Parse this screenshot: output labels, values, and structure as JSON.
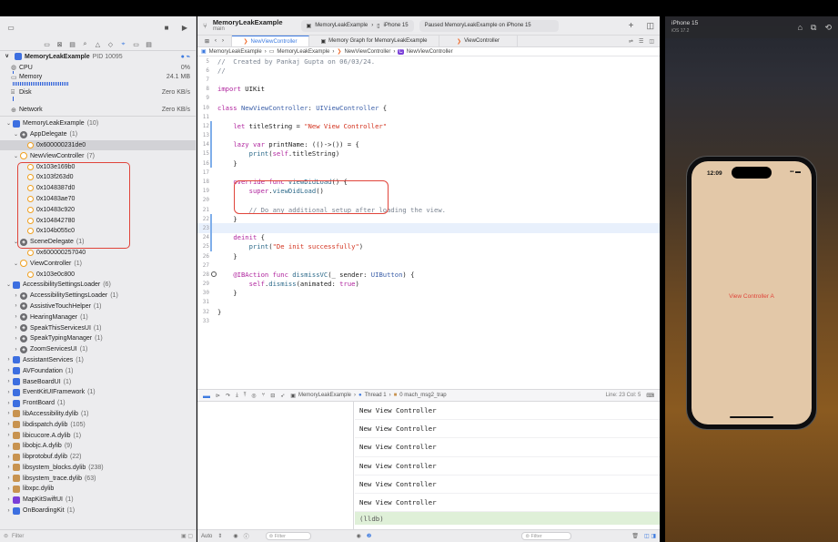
{
  "navigator": {
    "process": {
      "name": "MemoryLeakExample",
      "pid": "PID 10095"
    },
    "gauges": [
      {
        "label": "CPU",
        "value": "0%"
      },
      {
        "label": "Memory",
        "value": "24.1 MB"
      },
      {
        "label": "Disk",
        "value": "Zero KB/s"
      },
      {
        "label": "Network",
        "value": "Zero KB/s"
      }
    ],
    "tree": [
      {
        "indent": 0,
        "chev": "v",
        "icon": "blue",
        "label": "MemoryLeakExample",
        "count": "(10)"
      },
      {
        "indent": 1,
        "chev": "v",
        "icon": "gray",
        "label": "AppDelegate",
        "count": "(1)"
      },
      {
        "indent": 2,
        "chev": "",
        "icon": "obj",
        "label": "0x600000231de0",
        "count": "",
        "selected": true
      },
      {
        "indent": 1,
        "chev": "v",
        "icon": "orange",
        "label": "NewViewController",
        "count": "(7)"
      },
      {
        "indent": 2,
        "chev": "",
        "icon": "obj",
        "label": "0x103e169b0",
        "count": ""
      },
      {
        "indent": 2,
        "chev": "",
        "icon": "obj",
        "label": "0x103f263d0",
        "count": ""
      },
      {
        "indent": 2,
        "chev": "",
        "icon": "obj",
        "label": "0x1048387d0",
        "count": ""
      },
      {
        "indent": 2,
        "chev": "",
        "icon": "obj",
        "label": "0x10483ae70",
        "count": ""
      },
      {
        "indent": 2,
        "chev": "",
        "icon": "obj",
        "label": "0x10483c920",
        "count": ""
      },
      {
        "indent": 2,
        "chev": "",
        "icon": "obj",
        "label": "0x104842780",
        "count": ""
      },
      {
        "indent": 2,
        "chev": "",
        "icon": "obj",
        "label": "0x104b055c0",
        "count": ""
      },
      {
        "indent": 1,
        "chev": "v",
        "icon": "gray",
        "label": "SceneDelegate",
        "count": "(1)"
      },
      {
        "indent": 2,
        "chev": "",
        "icon": "obj",
        "label": "0x600000257040",
        "count": ""
      },
      {
        "indent": 1,
        "chev": "v",
        "icon": "orange",
        "label": "ViewController",
        "count": "(1)"
      },
      {
        "indent": 2,
        "chev": "",
        "icon": "obj",
        "label": "0x103e0c800",
        "count": ""
      },
      {
        "indent": 0,
        "chev": "v",
        "icon": "blue",
        "label": "AccessibilitySettingsLoader",
        "count": "(6)"
      },
      {
        "indent": 1,
        "chev": ">",
        "icon": "gray",
        "label": "AccessibilitySettingsLoader",
        "count": "(1)"
      },
      {
        "indent": 1,
        "chev": ">",
        "icon": "gray",
        "label": "AssistiveTouchHelper",
        "count": "(1)"
      },
      {
        "indent": 1,
        "chev": ">",
        "icon": "gray",
        "label": "HearingManager",
        "count": "(1)"
      },
      {
        "indent": 1,
        "chev": ">",
        "icon": "gray",
        "label": "SpeakThisServicesUI",
        "count": "(1)"
      },
      {
        "indent": 1,
        "chev": ">",
        "icon": "gray",
        "label": "SpeakTypingManager",
        "count": "(1)"
      },
      {
        "indent": 1,
        "chev": ">",
        "icon": "gray",
        "label": "ZoomServicesUI",
        "count": "(1)"
      },
      {
        "indent": 0,
        "chev": ">",
        "icon": "blue",
        "label": "AssistantServices",
        "count": "(1)"
      },
      {
        "indent": 0,
        "chev": ">",
        "icon": "blue",
        "label": "AVFoundation",
        "count": "(1)"
      },
      {
        "indent": 0,
        "chev": ">",
        "icon": "blue",
        "label": "BaseBoardUI",
        "count": "(1)"
      },
      {
        "indent": 0,
        "chev": ">",
        "icon": "blue",
        "label": "EventKitUIFramework",
        "count": "(1)"
      },
      {
        "indent": 0,
        "chev": ">",
        "icon": "blue",
        "label": "FrontBoard",
        "count": "(1)"
      },
      {
        "indent": 0,
        "chev": ">",
        "icon": "lib",
        "label": "libAccessibility.dylib",
        "count": "(1)"
      },
      {
        "indent": 0,
        "chev": ">",
        "icon": "lib",
        "label": "libdispatch.dylib",
        "count": "(105)"
      },
      {
        "indent": 0,
        "chev": ">",
        "icon": "lib",
        "label": "libicucore.A.dylib",
        "count": "(1)"
      },
      {
        "indent": 0,
        "chev": ">",
        "icon": "lib",
        "label": "libobjc.A.dylib",
        "count": "(9)"
      },
      {
        "indent": 0,
        "chev": ">",
        "icon": "lib",
        "label": "libprotobuf.dylib",
        "count": "(22)"
      },
      {
        "indent": 0,
        "chev": ">",
        "icon": "lib",
        "label": "libsystem_blocks.dylib",
        "count": "(238)"
      },
      {
        "indent": 0,
        "chev": ">",
        "icon": "lib",
        "label": "libsystem_trace.dylib",
        "count": "(63)"
      },
      {
        "indent": 0,
        "chev": ">",
        "icon": "lib",
        "label": "libxpc.dylib",
        "count": ""
      },
      {
        "indent": 0,
        "chev": ">",
        "icon": "swift",
        "label": "MapKitSwiftUI",
        "count": "(1)"
      },
      {
        "indent": 0,
        "chev": ">",
        "icon": "blue",
        "label": "OnBoardingKit",
        "count": "(1)"
      }
    ],
    "filter_placeholder": "Filter"
  },
  "toolbar": {
    "scheme_title": "MemoryLeakExample",
    "scheme_branch": "main",
    "destination_app": "MemoryLeakExample",
    "destination_device": "iPhone 15",
    "status": "Paused MemoryLeakExample on iPhone 15"
  },
  "tabs": [
    {
      "label": "NewViewController",
      "active": true
    },
    {
      "label": "Memory Graph for MemoryLeakExample",
      "active": false
    },
    {
      "label": "ViewController",
      "active": false
    }
  ],
  "jumpbar": [
    "MemoryLeakExample",
    "MemoryLeakExample",
    "NewViewController",
    "NewViewController"
  ],
  "code_lines": [
    {
      "n": "5",
      "t": [
        [
          "cm",
          "//  Created by Pankaj Gupta on 06/03/24."
        ]
      ]
    },
    {
      "n": "6",
      "t": [
        [
          "cm",
          "//"
        ]
      ]
    },
    {
      "n": "7",
      "t": []
    },
    {
      "n": "8",
      "t": [
        [
          "kw",
          "import"
        ],
        [
          "plain",
          " UIKit"
        ]
      ]
    },
    {
      "n": "9",
      "t": []
    },
    {
      "n": "10",
      "t": [
        [
          "kw",
          "class"
        ],
        [
          "plain",
          " "
        ],
        [
          "ty",
          "NewViewController"
        ],
        [
          "plain",
          ": "
        ],
        [
          "ty",
          "UIViewController"
        ],
        [
          "plain",
          " {"
        ]
      ]
    },
    {
      "n": "11",
      "t": []
    },
    {
      "n": "12",
      "t": [
        [
          "plain",
          "    "
        ],
        [
          "kw",
          "let"
        ],
        [
          "plain",
          " titleString = "
        ],
        [
          "str",
          "\"New View Controller\""
        ]
      ]
    },
    {
      "n": "13",
      "t": []
    },
    {
      "n": "14",
      "t": [
        [
          "plain",
          "    "
        ],
        [
          "kw",
          "lazy var"
        ],
        [
          "plain",
          " printName: (()->()) = {"
        ]
      ]
    },
    {
      "n": "15",
      "t": [
        [
          "plain",
          "        "
        ],
        [
          "fn",
          "print"
        ],
        [
          "plain",
          "("
        ],
        [
          "kw",
          "self"
        ],
        [
          "plain",
          ".titleString)"
        ]
      ]
    },
    {
      "n": "16",
      "t": [
        [
          "plain",
          "    }"
        ]
      ]
    },
    {
      "n": "17",
      "t": []
    },
    {
      "n": "18",
      "t": [
        [
          "plain",
          "    "
        ],
        [
          "kw",
          "override func"
        ],
        [
          "plain",
          " "
        ],
        [
          "fn",
          "viewDidLoad"
        ],
        [
          "plain",
          "() {"
        ]
      ]
    },
    {
      "n": "19",
      "t": [
        [
          "plain",
          "        "
        ],
        [
          "kw",
          "super"
        ],
        [
          "plain",
          "."
        ],
        [
          "fn",
          "viewDidLoad"
        ],
        [
          "plain",
          "()"
        ]
      ]
    },
    {
      "n": "20",
      "t": []
    },
    {
      "n": "21",
      "t": [
        [
          "plain",
          "        "
        ],
        [
          "cm",
          "// Do any additional setup after loading the view."
        ]
      ]
    },
    {
      "n": "22",
      "t": [
        [
          "plain",
          "    }"
        ]
      ]
    },
    {
      "n": "23",
      "t": [],
      "current": true
    },
    {
      "n": "24",
      "t": [
        [
          "plain",
          "    "
        ],
        [
          "kw",
          "deinit"
        ],
        [
          "plain",
          " {"
        ]
      ]
    },
    {
      "n": "25",
      "t": [
        [
          "plain",
          "        "
        ],
        [
          "fn",
          "print"
        ],
        [
          "plain",
          "("
        ],
        [
          "str",
          "\"De init successfully\""
        ],
        [
          "plain",
          ")"
        ]
      ]
    },
    {
      "n": "26",
      "t": [
        [
          "plain",
          "    }"
        ]
      ]
    },
    {
      "n": "27",
      "t": []
    },
    {
      "n": "28",
      "t": [
        [
          "plain",
          "    "
        ],
        [
          "kw",
          "@IBAction func"
        ],
        [
          "plain",
          " "
        ],
        [
          "fn",
          "dismissVC"
        ],
        [
          "plain",
          "(_ sender: "
        ],
        [
          "ty",
          "UIButton"
        ],
        [
          "plain",
          ") {"
        ]
      ]
    },
    {
      "n": "29",
      "t": [
        [
          "plain",
          "        "
        ],
        [
          "kw",
          "self"
        ],
        [
          "plain",
          "."
        ],
        [
          "fn",
          "dismiss"
        ],
        [
          "plain",
          "(animated: "
        ],
        [
          "kw",
          "true"
        ],
        [
          "plain",
          ")"
        ]
      ]
    },
    {
      "n": "30",
      "t": [
        [
          "plain",
          "    }"
        ]
      ]
    },
    {
      "n": "31",
      "t": []
    },
    {
      "n": "32",
      "t": [
        [
          "plain",
          "}"
        ]
      ]
    },
    {
      "n": "33",
      "t": []
    }
  ],
  "debugbar": {
    "crumbs": [
      "MemoryLeakExample",
      "Thread 1",
      "0 mach_msg2_trap"
    ],
    "line_col": "Line: 23  Col: 5"
  },
  "console": {
    "lines": [
      "New View Controller",
      "New View Controller",
      "New View Controller",
      "New View Controller",
      "New View Controller",
      "New View Controller"
    ],
    "prompt": "(lldb)"
  },
  "bottombar": {
    "auto_label": "Auto",
    "filter_placeholder": "Filter"
  },
  "simulator": {
    "device": "iPhone 15",
    "os": "iOS 17.2",
    "clock": "12:09",
    "screen_label": "View Controller A"
  },
  "colors": {
    "leak_highlight": "#e0443a",
    "accent": "#3c7ae0"
  }
}
